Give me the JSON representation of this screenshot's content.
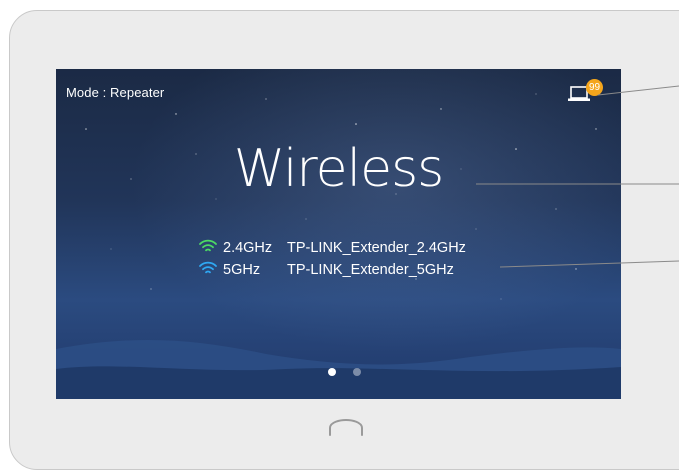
{
  "status_bar": {
    "mode_text": "Mode : Repeater",
    "clients_badge": "99"
  },
  "main": {
    "title": "Wireless"
  },
  "bands": [
    {
      "label": "2.4GHz",
      "ssid": "TP-LINK_Extender_2.4GHz",
      "icon": "wifi-icon",
      "color": "#4cd964"
    },
    {
      "label": "5GHz",
      "ssid": "TP-LINK_Extender_5GHz",
      "icon": "wifi-icon",
      "color": "#2fa8f2"
    }
  ],
  "pager": {
    "pages": 2,
    "active_page": 1
  },
  "colors": {
    "badge": "#f4a51c",
    "screen_bg": "#213559"
  }
}
